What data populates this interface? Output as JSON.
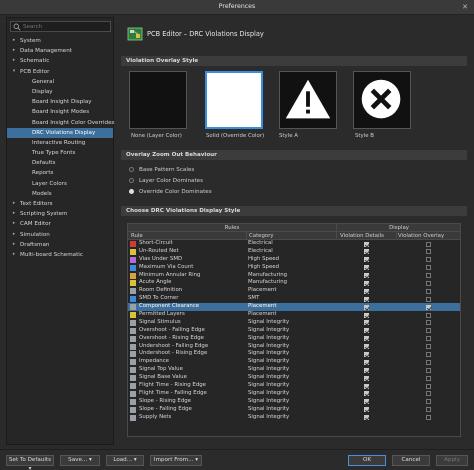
{
  "window": {
    "title": "Preferences"
  },
  "search": {
    "placeholder": "Search"
  },
  "tree": [
    {
      "label": "System",
      "indent": 0,
      "arrow": "▸",
      "selected": false
    },
    {
      "label": "Data Management",
      "indent": 0,
      "arrow": "▸",
      "selected": false
    },
    {
      "label": "Schematic",
      "indent": 0,
      "arrow": "▸",
      "selected": false
    },
    {
      "label": "PCB Editor",
      "indent": 0,
      "arrow": "▾",
      "selected": false
    },
    {
      "label": "General",
      "indent": 1,
      "arrow": "",
      "selected": false
    },
    {
      "label": "Display",
      "indent": 1,
      "arrow": "",
      "selected": false
    },
    {
      "label": "Board Insight Display",
      "indent": 1,
      "arrow": "",
      "selected": false
    },
    {
      "label": "Board Insight Modes",
      "indent": 1,
      "arrow": "",
      "selected": false
    },
    {
      "label": "Board Insight Color Overrides",
      "indent": 1,
      "arrow": "",
      "selected": false
    },
    {
      "label": "DRC Violations Display",
      "indent": 1,
      "arrow": "",
      "selected": true
    },
    {
      "label": "Interactive Routing",
      "indent": 1,
      "arrow": "",
      "selected": false
    },
    {
      "label": "True Type Fonts",
      "indent": 1,
      "arrow": "",
      "selected": false
    },
    {
      "label": "Defaults",
      "indent": 1,
      "arrow": "",
      "selected": false
    },
    {
      "label": "Reports",
      "indent": 1,
      "arrow": "",
      "selected": false
    },
    {
      "label": "Layer Colors",
      "indent": 1,
      "arrow": "",
      "selected": false
    },
    {
      "label": "Models",
      "indent": 1,
      "arrow": "",
      "selected": false
    },
    {
      "label": "Text Editors",
      "indent": 0,
      "arrow": "▸",
      "selected": false
    },
    {
      "label": "Scripting System",
      "indent": 0,
      "arrow": "▸",
      "selected": false
    },
    {
      "label": "CAM Editor",
      "indent": 0,
      "arrow": "▸",
      "selected": false
    },
    {
      "label": "Simulation",
      "indent": 0,
      "arrow": "▸",
      "selected": false
    },
    {
      "label": "Draftsman",
      "indent": 0,
      "arrow": "▸",
      "selected": false
    },
    {
      "label": "Multi-board Schematic",
      "indent": 0,
      "arrow": "▸",
      "selected": false
    }
  ],
  "header": {
    "title": "PCB Editor – DRC Violations Display"
  },
  "overlay_style": {
    "heading": "Violation Overlay Style",
    "options": [
      {
        "label": "None (Layer Color)",
        "kind": "black"
      },
      {
        "label": "Solid (Override Color)",
        "kind": "white"
      },
      {
        "label": "Style A",
        "kind": "warning"
      },
      {
        "label": "Style B",
        "kind": "cross"
      }
    ]
  },
  "zoom_out": {
    "heading": "Overlay Zoom Out Behaviour",
    "options": [
      {
        "label": "Base Pattern Scales",
        "checked": false
      },
      {
        "label": "Layer Color Dominates",
        "checked": false
      },
      {
        "label": "Override Color Dominates",
        "checked": true
      }
    ]
  },
  "drc_style": {
    "heading": "Choose DRC Violations Display Style",
    "group_rules": "Rules",
    "group_display": "Display",
    "col_rule": "Rule",
    "col_category": "Category",
    "col_details": "Violation Details",
    "col_overlay": "Violation Overlay",
    "rows": [
      {
        "name": "Short-Circuit",
        "category": "Electrical",
        "details": true,
        "overlay": false,
        "icon": "#d23b3b"
      },
      {
        "name": "Un-Routed Net",
        "category": "Electrical",
        "details": true,
        "overlay": false,
        "icon": "#d9c23a"
      },
      {
        "name": "Vias Under SMD",
        "category": "High Speed",
        "details": true,
        "overlay": false,
        "icon": "#b56ad8"
      },
      {
        "name": "Maximum Via Count",
        "category": "High Speed",
        "details": true,
        "overlay": false,
        "icon": "#3c8be0"
      },
      {
        "name": "Minimum Annular Ring",
        "category": "Manufacturing",
        "details": true,
        "overlay": false,
        "icon": "#d9a23a"
      },
      {
        "name": "Acute Angle",
        "category": "Manufacturing",
        "details": true,
        "overlay": false,
        "icon": "#d9c23a"
      },
      {
        "name": "Room Definition",
        "category": "Placement",
        "details": true,
        "overlay": false,
        "icon": "#9aa0a8"
      },
      {
        "name": "SMD To Corner",
        "category": "SMT",
        "details": true,
        "overlay": false,
        "icon": "#3c8be0"
      },
      {
        "name": "Component Clearance",
        "category": "Placement",
        "details": true,
        "overlay": true,
        "icon": "#9aa0a8"
      },
      {
        "name": "Permitted Layers",
        "category": "Placement",
        "details": true,
        "overlay": false,
        "icon": "#d9c23a"
      },
      {
        "name": "Signal Stimulus",
        "category": "Signal Integrity",
        "details": true,
        "overlay": false,
        "icon": "#9aa0a8"
      },
      {
        "name": "Overshoot - Falling Edge",
        "category": "Signal Integrity",
        "details": true,
        "overlay": false,
        "icon": "#9aa0a8"
      },
      {
        "name": "Overshoot - Rising Edge",
        "category": "Signal Integrity",
        "details": true,
        "overlay": false,
        "icon": "#9aa0a8"
      },
      {
        "name": "Undershoot - Falling Edge",
        "category": "Signal Integrity",
        "details": true,
        "overlay": false,
        "icon": "#9aa0a8"
      },
      {
        "name": "Undershoot - Rising Edge",
        "category": "Signal Integrity",
        "details": true,
        "overlay": false,
        "icon": "#9aa0a8"
      },
      {
        "name": "Impedance",
        "category": "Signal Integrity",
        "details": true,
        "overlay": false,
        "icon": "#9aa0a8"
      },
      {
        "name": "Signal Top Value",
        "category": "Signal Integrity",
        "details": true,
        "overlay": false,
        "icon": "#9aa0a8"
      },
      {
        "name": "Signal Base Value",
        "category": "Signal Integrity",
        "details": true,
        "overlay": false,
        "icon": "#9aa0a8"
      },
      {
        "name": "Flight Time - Rising Edge",
        "category": "Signal Integrity",
        "details": true,
        "overlay": false,
        "icon": "#9aa0a8"
      },
      {
        "name": "Flight Time - Falling Edge",
        "category": "Signal Integrity",
        "details": true,
        "overlay": false,
        "icon": "#9aa0a8"
      },
      {
        "name": "Slope - Rising Edge",
        "category": "Signal Integrity",
        "details": true,
        "overlay": false,
        "icon": "#9aa0a8"
      },
      {
        "name": "Slope - Falling Edge",
        "category": "Signal Integrity",
        "details": true,
        "overlay": false,
        "icon": "#9aa0a8"
      },
      {
        "name": "Supply Nets",
        "category": "Signal Integrity",
        "details": true,
        "overlay": false,
        "icon": "#9aa0a8"
      }
    ]
  },
  "footer": {
    "set_defaults": "Set To Defaults",
    "save": "Save...",
    "load": "Load...",
    "import_from": "Import From...",
    "ok": "OK",
    "cancel": "Cancel",
    "apply": "Apply"
  }
}
